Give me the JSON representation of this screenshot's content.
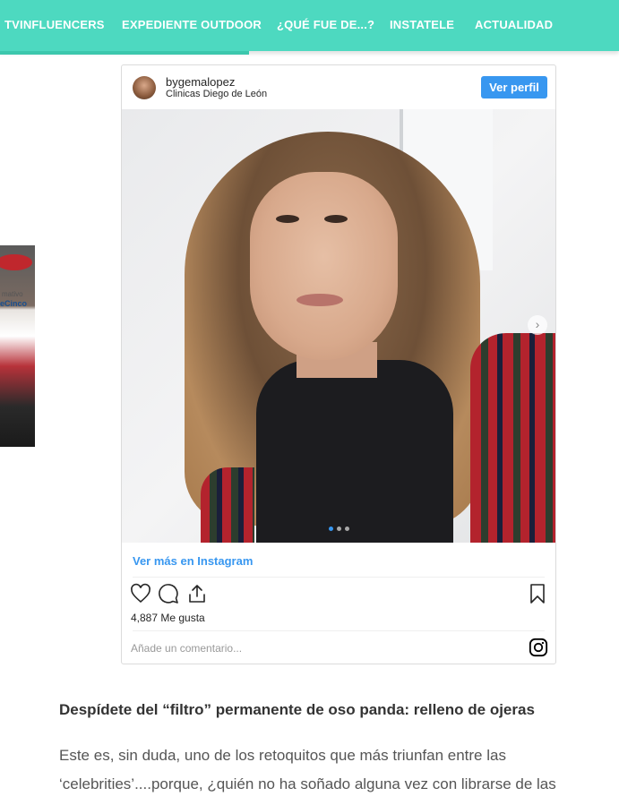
{
  "nav": {
    "items": [
      {
        "label": "TVINFLUENCERS"
      },
      {
        "label": "EXPEDIENTE OUTDOOR"
      },
      {
        "label": "¿QUÉ FUE DE...?"
      },
      {
        "label": "INSTATELE"
      },
      {
        "label": "ACTUALIDAD"
      }
    ]
  },
  "side_thumb": {
    "text_top": "mativo",
    "text_brand": "eCinco"
  },
  "instagram": {
    "username": "bygemalopez",
    "location": "Clinicas Diego de León",
    "follow_label": "Ver perfil",
    "more_label": "Ver más en Instagram",
    "likes": "4,887 Me gusta",
    "comment_placeholder": "Añade un comentario...",
    "carousel_dots": 3,
    "carousel_active": 1,
    "icons": [
      "heart-icon",
      "comment-icon",
      "share-icon",
      "bookmark-icon",
      "instagram-icon",
      "chevron-right-icon"
    ],
    "accent": "#3897f0"
  },
  "nav_color": "#4dd9c0",
  "article": {
    "heading": "Despídete del “filtro” permanente de oso panda: relleno de ojeras",
    "lines": [
      "Este es, sin duda, uno de los retoquitos que más triunfan entre las",
      "‘celebrities’....porque, ¿quién no ha soñado alguna vez con librarse de las"
    ]
  }
}
